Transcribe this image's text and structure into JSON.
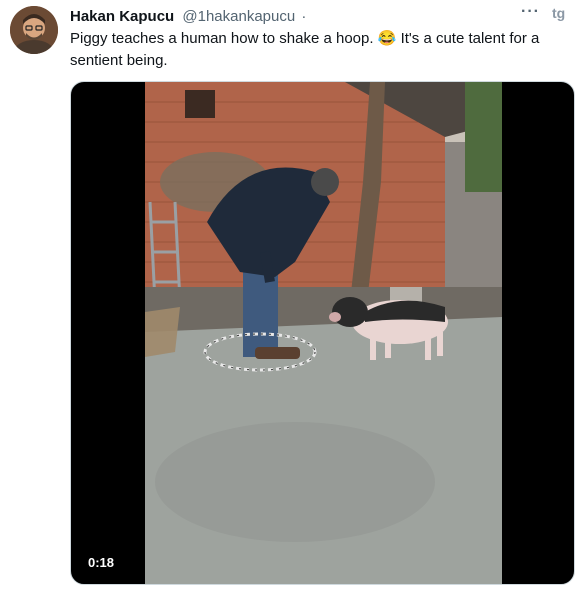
{
  "author": {
    "display_name": "Hakan Kapucu",
    "handle": "@1hakankapucu",
    "separator": "·"
  },
  "tweet": {
    "text_part1": "Piggy teaches a human how to shake a hoop. ",
    "emoji": "😂",
    "text_part2": " It's a cute talent for a sentient being."
  },
  "media": {
    "type": "video",
    "duration": "0:18"
  },
  "toolbar": {
    "more_label": "···",
    "extension_icon": "tg-extension-icon"
  },
  "colors": {
    "name": "#0f1419",
    "secondary": "#536471",
    "video_bg": "#000000",
    "ground": "#9ea39e",
    "brick": "#b0644a"
  }
}
